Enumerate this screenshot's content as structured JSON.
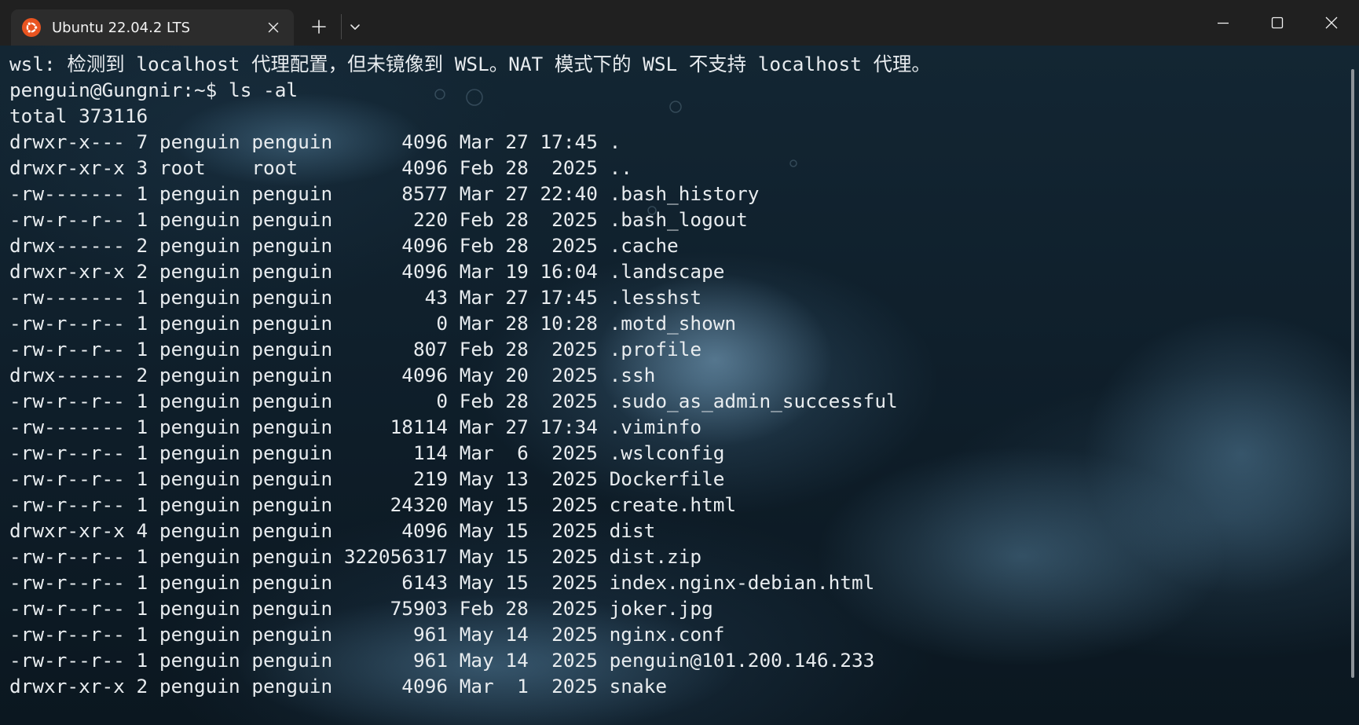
{
  "titlebar": {
    "tab_title": "Ubuntu 22.04.2 LTS",
    "tab_icon": "ubuntu-logo-icon",
    "new_tab_icon": "plus-icon",
    "dropdown_icon": "chevron-down-icon",
    "window_buttons": [
      "minimize-icon",
      "maximize-icon",
      "close-icon"
    ]
  },
  "colors": {
    "titlebar_bg": "#202020",
    "tab_bg": "#2c2c2c",
    "terminal_text": "#e8ecef",
    "ubuntu_orange": "#e95420"
  },
  "terminal": {
    "lines": [
      "wsl: 检测到 localhost 代理配置，但未镜像到 WSL。NAT 模式下的 WSL 不支持 localhost 代理。",
      "penguin@Gungnir:~$ ls -al",
      "total 373116",
      "drwxr-x--- 7 penguin penguin      4096 Mar 27 17:45 .",
      "drwxr-xr-x 3 root    root         4096 Feb 28  2025 ..",
      "-rw------- 1 penguin penguin      8577 Mar 27 22:40 .bash_history",
      "-rw-r--r-- 1 penguin penguin       220 Feb 28  2025 .bash_logout",
      "drwx------ 2 penguin penguin      4096 Feb 28  2025 .cache",
      "drwxr-xr-x 2 penguin penguin      4096 Mar 19 16:04 .landscape",
      "-rw------- 1 penguin penguin        43 Mar 27 17:45 .lesshst",
      "-rw-r--r-- 1 penguin penguin         0 Mar 28 10:28 .motd_shown",
      "-rw-r--r-- 1 penguin penguin       807 Feb 28  2025 .profile",
      "drwx------ 2 penguin penguin      4096 May 20  2025 .ssh",
      "-rw-r--r-- 1 penguin penguin         0 Feb 28  2025 .sudo_as_admin_successful",
      "-rw------- 1 penguin penguin     18114 Mar 27 17:34 .viminfo",
      "-rw-r--r-- 1 penguin penguin       114 Mar  6  2025 .wslconfig",
      "-rw-r--r-- 1 penguin penguin       219 May 13  2025 Dockerfile",
      "-rw-r--r-- 1 penguin penguin     24320 May 15  2025 create.html",
      "drwxr-xr-x 4 penguin penguin      4096 May 15  2025 dist",
      "-rw-r--r-- 1 penguin penguin 322056317 May 15  2025 dist.zip",
      "-rw-r--r-- 1 penguin penguin      6143 May 15  2025 index.nginx-debian.html",
      "-rw-r--r-- 1 penguin penguin     75903 Feb 28  2025 joker.jpg",
      "-rw-r--r-- 1 penguin penguin       961 May 14  2025 nginx.conf",
      "-rw-r--r-- 1 penguin penguin       961 May 14  2025 penguin@101.200.146.233",
      "drwxr-xr-x 2 penguin penguin      4096 Mar  1  2025 snake"
    ]
  }
}
